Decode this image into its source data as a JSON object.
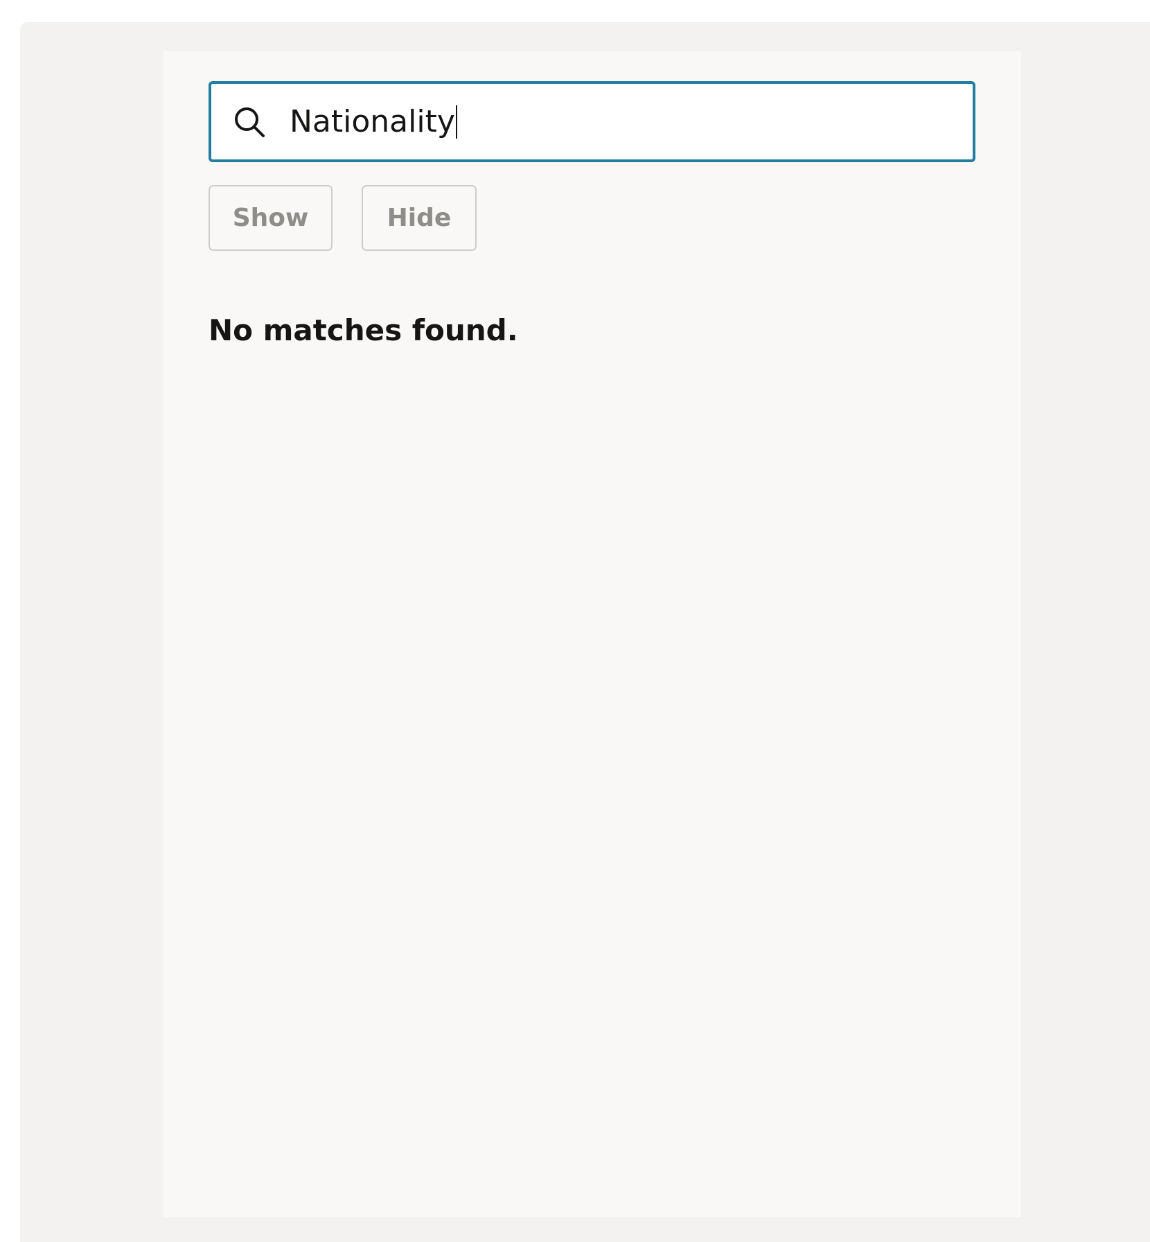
{
  "search": {
    "value": "Nationality",
    "icon": "search-icon"
  },
  "actions": {
    "show_label": "Show",
    "hide_label": "Hide"
  },
  "results": {
    "empty_message": "No matches found."
  },
  "colors": {
    "focus_border": "#227e9e",
    "outer_background": "#f3f2f1",
    "panel_background": "#f9f8f6",
    "disabled_text": "#8e8d8a",
    "text": "#161513"
  }
}
